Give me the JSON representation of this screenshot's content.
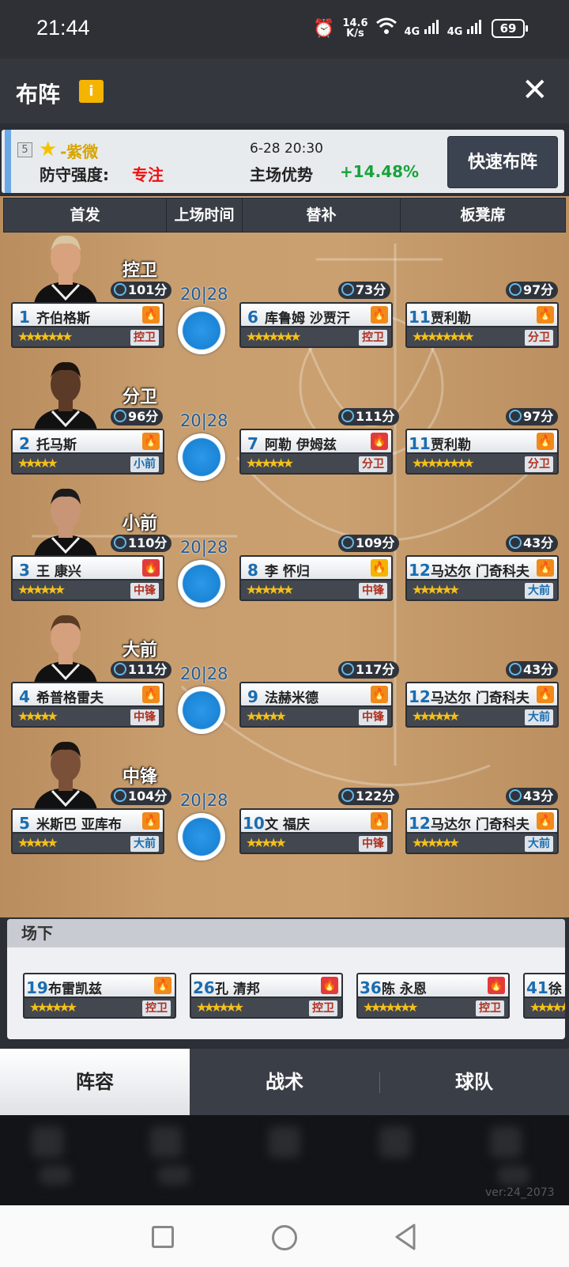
{
  "status_bar": {
    "time": "21:44",
    "net_speed_top": "14.6",
    "net_speed_unit": "K/s",
    "signal_1": "4G",
    "signal_2": "4G",
    "battery": "69"
  },
  "header": {
    "title": "布阵",
    "info_icon": "i"
  },
  "match_info": {
    "level": "5",
    "grade": "-紫微",
    "defense_label": "防守强度:",
    "defense_value": "专注",
    "datetime": "6-28 20:30",
    "home_label": "主场优势",
    "home_value": "+14.48%",
    "quick_button": "快速布阵"
  },
  "columns": [
    "首发",
    "上场时间",
    "替补",
    "板凳席"
  ],
  "rows": [
    {
      "pos": "控卫",
      "time": "20|28",
      "starter": {
        "num": "1",
        "name": "齐伯格斯",
        "mins": "101分",
        "stars": "★★★★★★★",
        "tag": "控卫",
        "fire": "orange"
      },
      "sub": {
        "num": "6",
        "name": "库鲁姆 沙贾汗",
        "mins": "73分",
        "stars": "★★★★★★★",
        "tag": "控卫",
        "fire": "orange"
      },
      "bench": {
        "num": "11",
        "name": "贾利勒",
        "mins": "97分",
        "stars": "★★★★★★★★",
        "tag": "分卫",
        "fire": "orange"
      }
    },
    {
      "pos": "分卫",
      "time": "20|28",
      "starter": {
        "num": "2",
        "name": "托马斯",
        "mins": "96分",
        "stars": "★★★★★",
        "tag": "小前",
        "fire": "orange"
      },
      "sub": {
        "num": "7",
        "name": "阿勒 伊姆兹",
        "mins": "111分",
        "stars": "★★★★★★",
        "tag": "分卫",
        "fire": "red"
      },
      "bench": {
        "num": "11",
        "name": "贾利勒",
        "mins": "97分",
        "stars": "★★★★★★★★",
        "tag": "分卫",
        "fire": "orange"
      }
    },
    {
      "pos": "小前",
      "time": "20|28",
      "starter": {
        "num": "3",
        "name": "王 康兴",
        "mins": "110分",
        "stars": "★★★★★★",
        "tag": "中锋",
        "fire": "red"
      },
      "sub": {
        "num": "8",
        "name": "李 怀归",
        "mins": "109分",
        "stars": "★★★★★★",
        "tag": "中锋",
        "fire": "yellow"
      },
      "bench": {
        "num": "12",
        "name": "马达尔 门奇科夫",
        "mins": "43分",
        "stars": "★★★★★★",
        "tag": "大前",
        "fire": "orange"
      }
    },
    {
      "pos": "大前",
      "time": "20|28",
      "starter": {
        "num": "4",
        "name": "希普格雷夫",
        "mins": "111分",
        "stars": "★★★★★",
        "tag": "中锋",
        "fire": "orange"
      },
      "sub": {
        "num": "9",
        "name": "法赫米德",
        "mins": "117分",
        "stars": "★★★★★",
        "tag": "中锋",
        "fire": "orange"
      },
      "bench": {
        "num": "12",
        "name": "马达尔 门奇科夫",
        "mins": "43分",
        "stars": "★★★★★★",
        "tag": "大前",
        "fire": "orange"
      }
    },
    {
      "pos": "中锋",
      "time": "20|28",
      "starter": {
        "num": "5",
        "name": "米斯巴 亚库布",
        "mins": "104分",
        "stars": "★★★★★",
        "tag": "大前",
        "fire": "orange"
      },
      "sub": {
        "num": "10",
        "name": "文 福庆",
        "mins": "122分",
        "stars": "★★★★★",
        "tag": "中锋",
        "fire": "orange"
      },
      "bench": {
        "num": "12",
        "name": "马达尔 门奇科夫",
        "mins": "43分",
        "stars": "★★★★★★",
        "tag": "大前",
        "fire": "orange"
      }
    }
  ],
  "reserves": {
    "title": "场下",
    "players": [
      {
        "num": "19",
        "name": "布雷凯兹",
        "stars": "★★★★★★",
        "tag": "控卫",
        "fire": "orange"
      },
      {
        "num": "26",
        "name": "孔 清邦",
        "stars": "★★★★★★",
        "tag": "控卫",
        "fire": "red"
      },
      {
        "num": "36",
        "name": "陈 永恩",
        "stars": "★★★★★★★",
        "tag": "控卫",
        "fire": "red"
      },
      {
        "num": "41",
        "name": "徐",
        "stars": "★★★★★",
        "tag": "",
        "fire": ""
      }
    ]
  },
  "tabs": [
    "阵容",
    "战术",
    "球队"
  ],
  "version": "ver:24_2073",
  "colors": {
    "accent_blue": "#1b84d6",
    "green": "#18a33a",
    "red": "#e11",
    "fire_orange": "#f08a1a",
    "fire_red": "#e23b3b",
    "fire_yellow": "#f4b400"
  }
}
